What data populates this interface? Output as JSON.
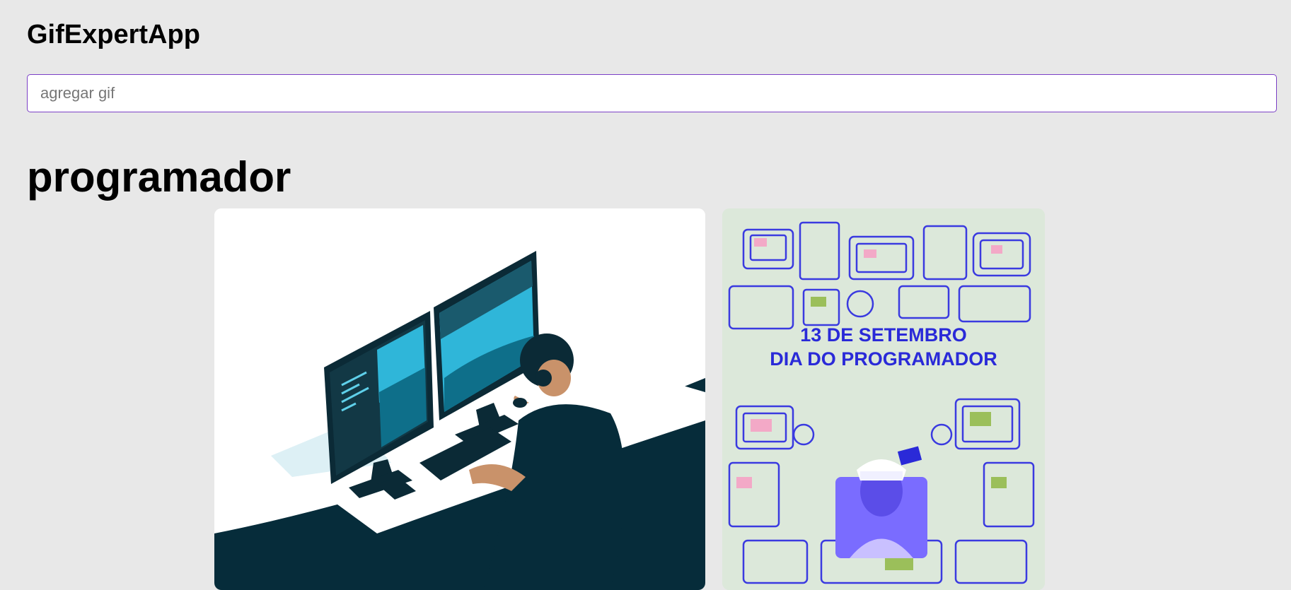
{
  "app": {
    "title": "GifExpertApp"
  },
  "search": {
    "placeholder": "agregar gif",
    "value": ""
  },
  "category": {
    "title": "programador"
  },
  "gifs": [
    {
      "kind": "illustration",
      "subject": "developer at two monitors"
    },
    {
      "kind": "poster",
      "lines": [
        "13 DE SETEMBRO",
        "DIA DO PROGRAMADOR"
      ]
    }
  ],
  "colors": {
    "background": "#e8e8e8",
    "input_border": "#7b3fc6",
    "poster_text": "#2a2ad8",
    "illustration_dark": "#062c3a",
    "illustration_accent": "#2fb6d9"
  }
}
